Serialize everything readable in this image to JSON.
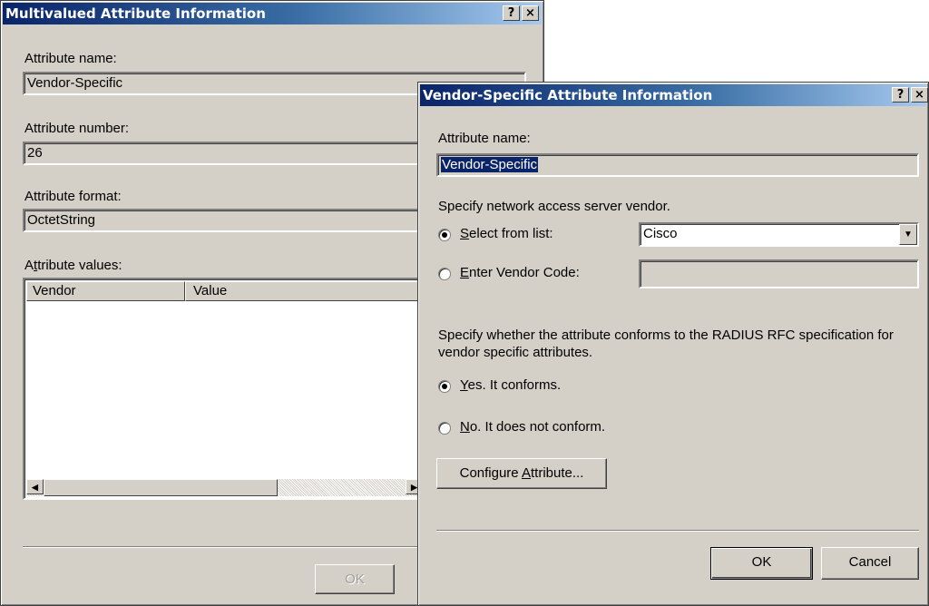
{
  "back_dialog": {
    "title": "Multivalued Attribute Information",
    "help": "?",
    "close": "×",
    "attr_name_label": "Attribute name:",
    "attr_name_value": "Vendor-Specific",
    "attr_number_label": "Attribute number:",
    "attr_number_value": "26",
    "attr_format_label": "Attribute format:",
    "attr_format_value": "OctetString",
    "attr_values_label_pre": "A",
    "attr_values_label_u": "t",
    "attr_values_label_post": "tribute values:",
    "columns": [
      "Vendor",
      "Value"
    ],
    "ok_label": "OK",
    "scroll_left": "◀",
    "scroll_right": "▶"
  },
  "front_dialog": {
    "title": "Vendor-Specific Attribute Information",
    "help": "?",
    "close": "×",
    "attr_name_label": "Attribute name:",
    "attr_name_value": "Vendor-Specific",
    "vendor_prompt": "Specify network access server vendor.",
    "select_list_u": "S",
    "select_list_rest": "elect from list:",
    "vendor_selected": "Cisco",
    "dropdown_arrow": "▼",
    "enter_code_u": "E",
    "enter_code_rest": "nter Vendor Code:",
    "vendor_code_value": "",
    "conform_prompt_line1": "Specify whether the attribute conforms to the RADIUS RFC specification for",
    "conform_prompt_line2": "vendor specific attributes.",
    "yes_u": "Y",
    "yes_rest": "es. It conforms.",
    "no_u": "N",
    "no_rest": "o. It does not conform.",
    "configure_pre": "Configure ",
    "configure_u": "A",
    "configure_post": "ttribute...",
    "ok_label": "OK",
    "cancel_label": "Cancel"
  }
}
